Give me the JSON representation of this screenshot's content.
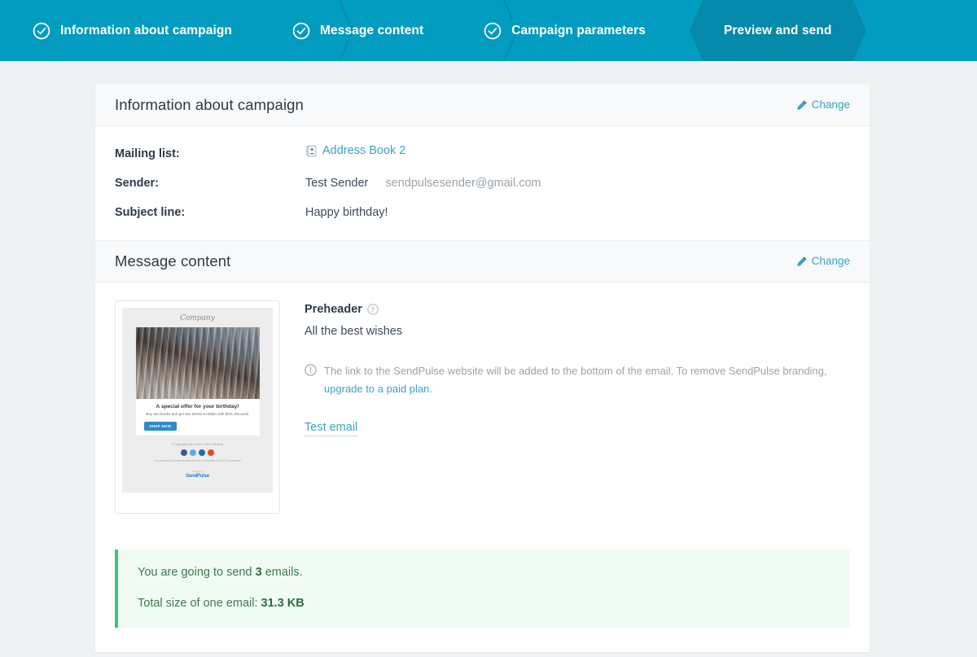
{
  "steps": [
    {
      "label": "Information about campaign",
      "completed": true,
      "active": false,
      "icon": "check-circle-icon"
    },
    {
      "label": "Message content",
      "completed": true,
      "active": false,
      "icon": "check-circle-icon"
    },
    {
      "label": "Campaign parameters",
      "completed": true,
      "active": false,
      "icon": "check-circle-icon"
    },
    {
      "label": "Preview and send",
      "completed": false,
      "active": true,
      "icon": ""
    }
  ],
  "colors": {
    "nav_background": "#039cc1",
    "nav_active": "#0489ab",
    "link": "#3ba3c4",
    "page_background": "#eff2f3",
    "summary_accent": "#3fc47e",
    "summary_background": "#f0fcf3"
  },
  "campaign_section": {
    "title": "Information about campaign",
    "change_label": "Change",
    "change_icon": "pencil-icon",
    "rows": [
      {
        "label": "Mailing list:",
        "value": "Address Book 2",
        "icon": "address-book-icon",
        "is_link": true
      },
      {
        "label": "Sender:",
        "value": "Test Sender",
        "secondary": "sendpulsesender@gmail.com",
        "is_link": false
      },
      {
        "label": "Subject line:",
        "value": "Happy birthday!",
        "is_link": false
      }
    ]
  },
  "message_section": {
    "title": "Message content",
    "change_label": "Change",
    "change_icon": "pencil-icon",
    "preheader": {
      "label": "Preheader",
      "help_icon": "help-circle-icon",
      "text": "All the best wishes"
    },
    "notice": {
      "icon": "exclamation-circle-icon",
      "text": "The link to the SendPulse website will be added to the bottom of the email. To remove SendPulse branding,",
      "link_label": "upgrade to a paid plan."
    },
    "test_email_label": "Test email",
    "thumbnail": {
      "logo": "Company",
      "headline": "A special offer for your birthday!",
      "subtext": "Buy two books and get two tickets to Milan with 50% discount!",
      "button_label": "SHOP NOW",
      "copyright": "© Copyright 2014-2019 | CMS | BRAND",
      "social_icons": [
        {
          "name": "facebook-icon",
          "color": "#3b5998"
        },
        {
          "name": "twitter-icon",
          "color": "#55acee"
        },
        {
          "name": "linkedin-icon",
          "color": "#2867b2"
        },
        {
          "name": "google-plus-icon",
          "color": "#e8462b"
        }
      ],
      "legal": "You received this email because you are a subscriber of BEST Unsubscribe",
      "powered_by": "Powered by",
      "brand": "SendPulse"
    }
  },
  "summary": {
    "line1_prefix": "You are going to send ",
    "line1_count": "3",
    "line1_suffix": " emails.",
    "line2_prefix": "Total size of one email: ",
    "line2_size": "31.3 KB"
  }
}
